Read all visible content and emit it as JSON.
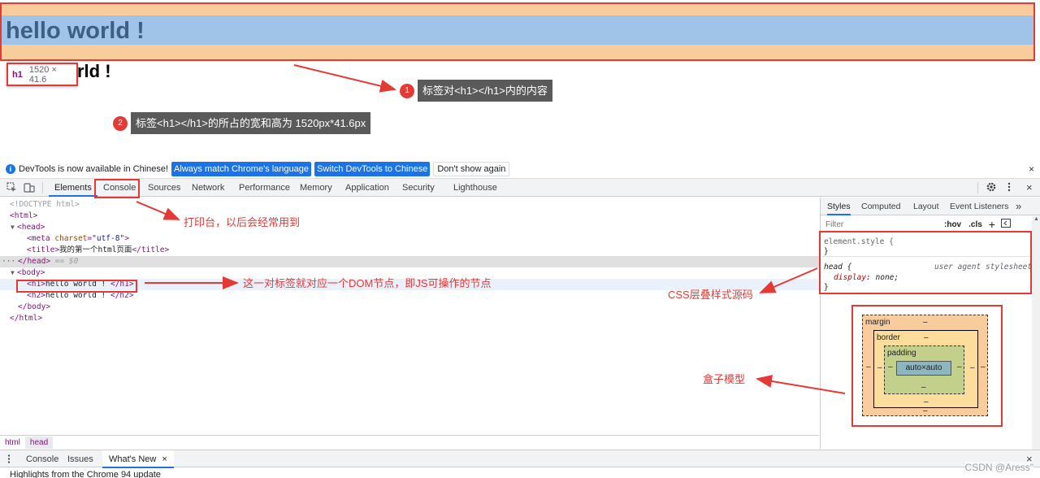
{
  "viewport": {
    "h1_text": "hello world !",
    "h2_text": "hello world !",
    "tooltip": {
      "tag": "h1",
      "dimensions": "1520 × 41.6"
    }
  },
  "annotations": {
    "badge1": "1",
    "note1": "标签对<h1></h1>内的内容",
    "badge2": "2",
    "note2": "标签<h1></h1>的所占的宽和高为 1520px*41.6px",
    "console_note": "打印台，以后会经常用到",
    "dom_note": "这一对标签就对应一个DOM节点，即JS可操作的节点",
    "css_note": "CSS层叠样式源码",
    "box_note": "盒子模型"
  },
  "infobar": {
    "message": "DevTools is now available in Chinese!",
    "btn_match": "Always match Chrome's language",
    "btn_switch": "Switch DevTools to Chinese",
    "btn_dont_show": "Don't show again",
    "close": "×"
  },
  "toolbar": {
    "tabs": [
      "Elements",
      "Console",
      "Sources",
      "Network",
      "Performance",
      "Memory",
      "Application",
      "Security",
      "Lighthouse"
    ],
    "close": "×"
  },
  "dom": {
    "doctype": "<!DOCTYPE html>",
    "html_open": "<html>",
    "head_open": "<head>",
    "meta": {
      "tag": "meta",
      "attr": "charset",
      "value": "\"utf-8\""
    },
    "title": {
      "open": "<title>",
      "text": "我的第一个html页面",
      "close": "</title>"
    },
    "head_close": "</head>",
    "head_suffix": " == $0",
    "body_open": "<body>",
    "h1": {
      "open": "<h1>",
      "text": "hello world ! ",
      "close": "</h1>"
    },
    "h2": {
      "open": "<h2>",
      "text": "hello world ! ",
      "close": "</h2>"
    },
    "body_close": "</body>",
    "html_close": "</html>"
  },
  "breadcrumbs": [
    "html",
    "head"
  ],
  "styles": {
    "tabs": [
      "Styles",
      "Computed",
      "Layout",
      "Event Listeners",
      "»"
    ],
    "filter_placeholder": "Filter",
    "hov": ":hov",
    "cls": ".cls",
    "plus": "+",
    "rule1_selector": "element.style {",
    "rule1_close": "}",
    "rule2_selector": "head {",
    "rule2_source": "user agent stylesheet",
    "rule2_prop": "display",
    "rule2_value": "none;",
    "rule2_close": "}"
  },
  "box_model": {
    "margin_label": "margin",
    "border_label": "border",
    "padding_label": "padding",
    "content": "auto×auto",
    "dash": "–"
  },
  "drawer": {
    "tabs": [
      "Console",
      "Issues",
      "What's New"
    ],
    "close": "×",
    "message": "Highlights from the Chrome 94 update"
  },
  "watermark": "CSDN @Aress\"",
  "colors": {
    "margin": "#f9cc9d",
    "content": "#9fc4e7",
    "annotation_red": "#e53935",
    "accent_blue": "#1a73e8"
  }
}
